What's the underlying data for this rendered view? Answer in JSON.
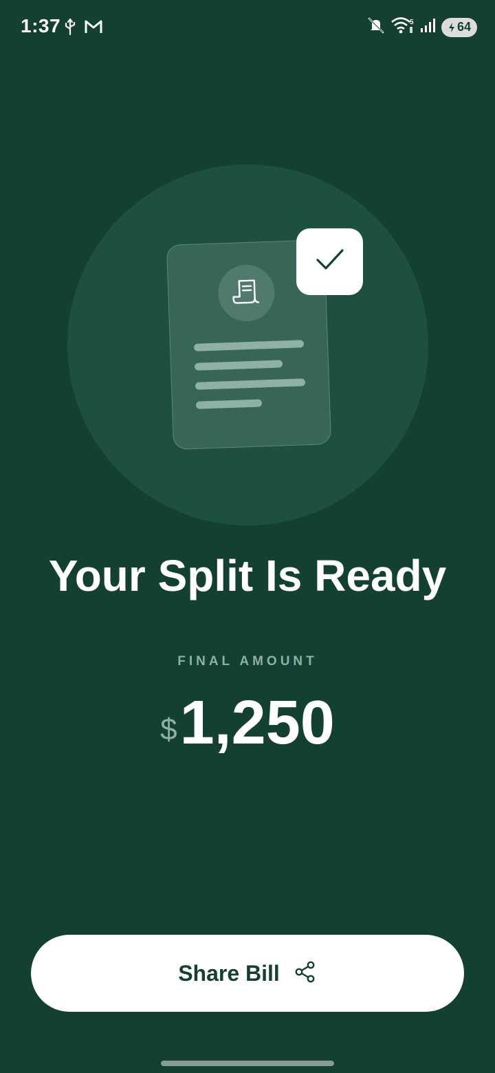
{
  "status_bar": {
    "time": "1:37",
    "left_icons": [
      "usb-icon",
      "gmail-icon"
    ],
    "right_icons": [
      "mute-icon",
      "wifi-icon",
      "signal-icon"
    ],
    "battery": "64"
  },
  "illustration": {
    "icons": [
      "receipt-icon",
      "check-icon"
    ]
  },
  "main": {
    "title": "Your Split Is Ready",
    "final_label": "FINAL AMOUNT",
    "currency": "$",
    "amount": "1,250"
  },
  "share_button": {
    "label": "Share Bill",
    "icon": "share-icon"
  },
  "colors": {
    "background": "#143f33",
    "circle": "#1d5041",
    "accent_muted": "#8fb0a6",
    "button": "#ffffff"
  }
}
